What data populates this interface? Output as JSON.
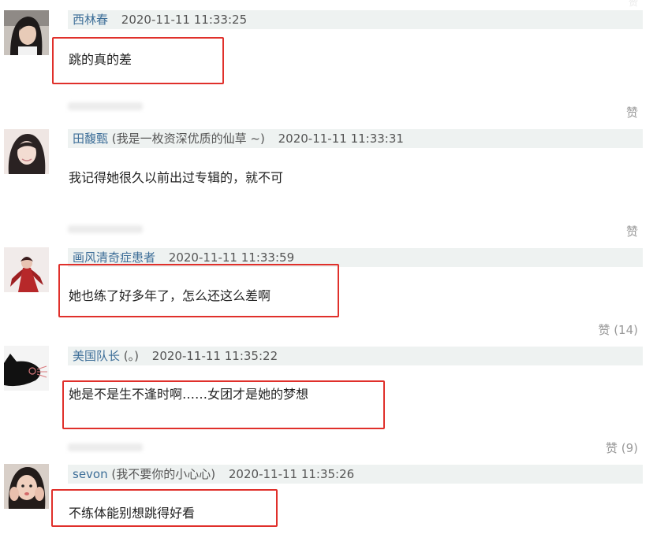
{
  "top_like_fragment": "赞",
  "comments": [
    {
      "username": "西林春",
      "note": "",
      "time": "2020-11-11 11:33:25",
      "text": "跳的真的差",
      "like": "赞",
      "highlighted": true,
      "avatar_icon": "avatar-woman-dark-hair"
    },
    {
      "username": "田馥甄",
      "note": "(我是一枚资深优质的仙草 ~)",
      "time": "2020-11-11 11:33:31",
      "text": "我记得她很久以前出过专辑的，就不可",
      "like": "赞",
      "highlighted": false,
      "avatar_icon": "avatar-woman-long-hair"
    },
    {
      "username": "画风清奇症患者",
      "note": "",
      "time": "2020-11-11 11:33:59",
      "text": "她也练了好多年了，怎么还这么差啊",
      "like": "赞 (14)",
      "highlighted": true,
      "avatar_icon": "avatar-red-dress"
    },
    {
      "username": "美国队长",
      "note": "(。)",
      "time": "2020-11-11 11:35:22",
      "text": "她是不是生不逢时啊……女团才是她的梦想",
      "like": "赞 (9)",
      "highlighted": true,
      "avatar_icon": "avatar-black-cat"
    },
    {
      "username": "sevon",
      "note": "(我不要你的小心心)",
      "time": "2020-11-11 11:35:26",
      "text": "不练体能别想跳得好看",
      "like": "",
      "highlighted": true,
      "avatar_icon": "avatar-woman-hands-on-face"
    }
  ],
  "colors": {
    "username": "#3d6e98",
    "header_bg": "#eef2f1",
    "highlight_border": "#e0302b",
    "like": "#999999"
  }
}
